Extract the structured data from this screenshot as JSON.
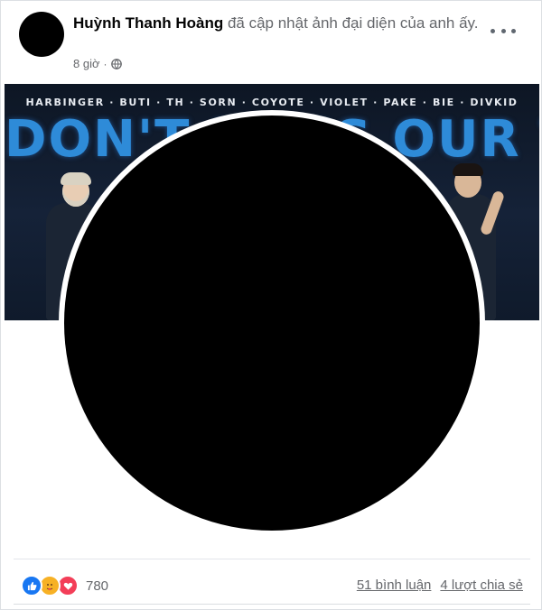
{
  "post": {
    "author_name": "Huỳnh Thanh Hoàng",
    "action_text": " đã cập nhật ảnh đại diện của anh ấy.",
    "timestamp": "8 giờ",
    "separator": "·",
    "privacy_icon": "globe-icon",
    "more_icon": "more-options-icon"
  },
  "cover": {
    "roster": "HARBINGER · BUTI · TH · SORN · COYOTE · VIOLET · PAKE · BIE · DIVKID",
    "slogan": "DON'T MESS OUR TEAM DO"
  },
  "footer": {
    "reaction_icons": [
      "like-icon",
      "care-icon",
      "love-icon"
    ],
    "reaction_count": "780",
    "comments": "51 bình luận",
    "shares": "4 lượt chia sẻ"
  },
  "colors": {
    "like": "#1877f2",
    "care": "#f7b125",
    "love": "#f33e58",
    "slogan": "#2e8bd8",
    "secondary_text": "#65676b"
  }
}
